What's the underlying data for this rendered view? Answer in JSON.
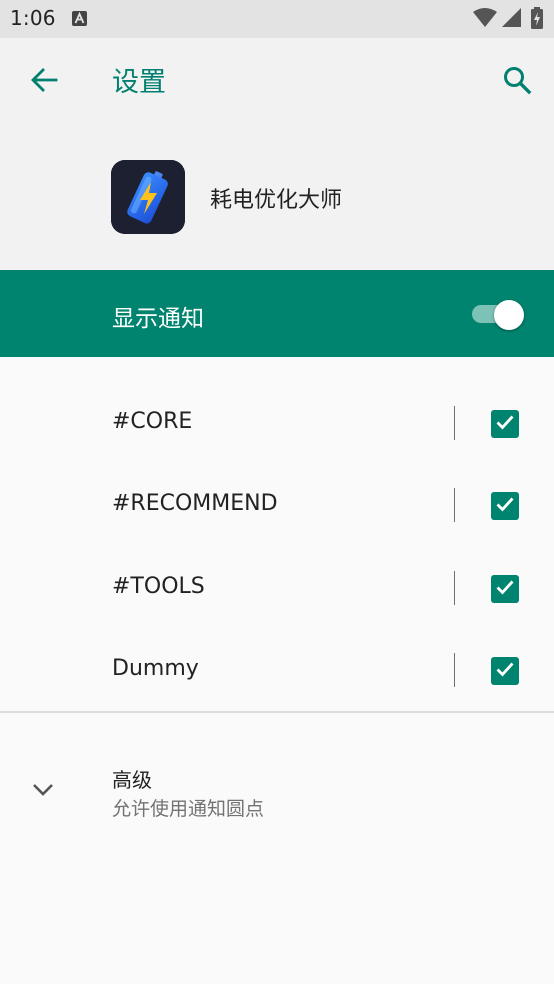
{
  "status_bar": {
    "time": "1:06",
    "notification_icon": "a-keyboard-icon",
    "wifi_icon": "wifi-icon",
    "signal_icon": "signal-icon",
    "battery_icon": "battery-charging-icon"
  },
  "app_bar": {
    "back_icon": "arrow-back-icon",
    "title": "设置",
    "search_icon": "search-icon",
    "accent_color": "#00806e"
  },
  "app_info": {
    "name": "耗电优化大师",
    "icon": "battery-bolt-icon"
  },
  "master_switch": {
    "label": "显示通知",
    "enabled": true,
    "background_color": "#00846f"
  },
  "channels": [
    {
      "label": "#CORE",
      "checked": true
    },
    {
      "label": "#RECOMMEND",
      "checked": true
    },
    {
      "label": "#TOOLS",
      "checked": true
    },
    {
      "label": "Dummy",
      "checked": true
    }
  ],
  "advanced": {
    "expand_icon": "chevron-down-icon",
    "title": "高级",
    "summary": "允许使用通知圆点"
  }
}
